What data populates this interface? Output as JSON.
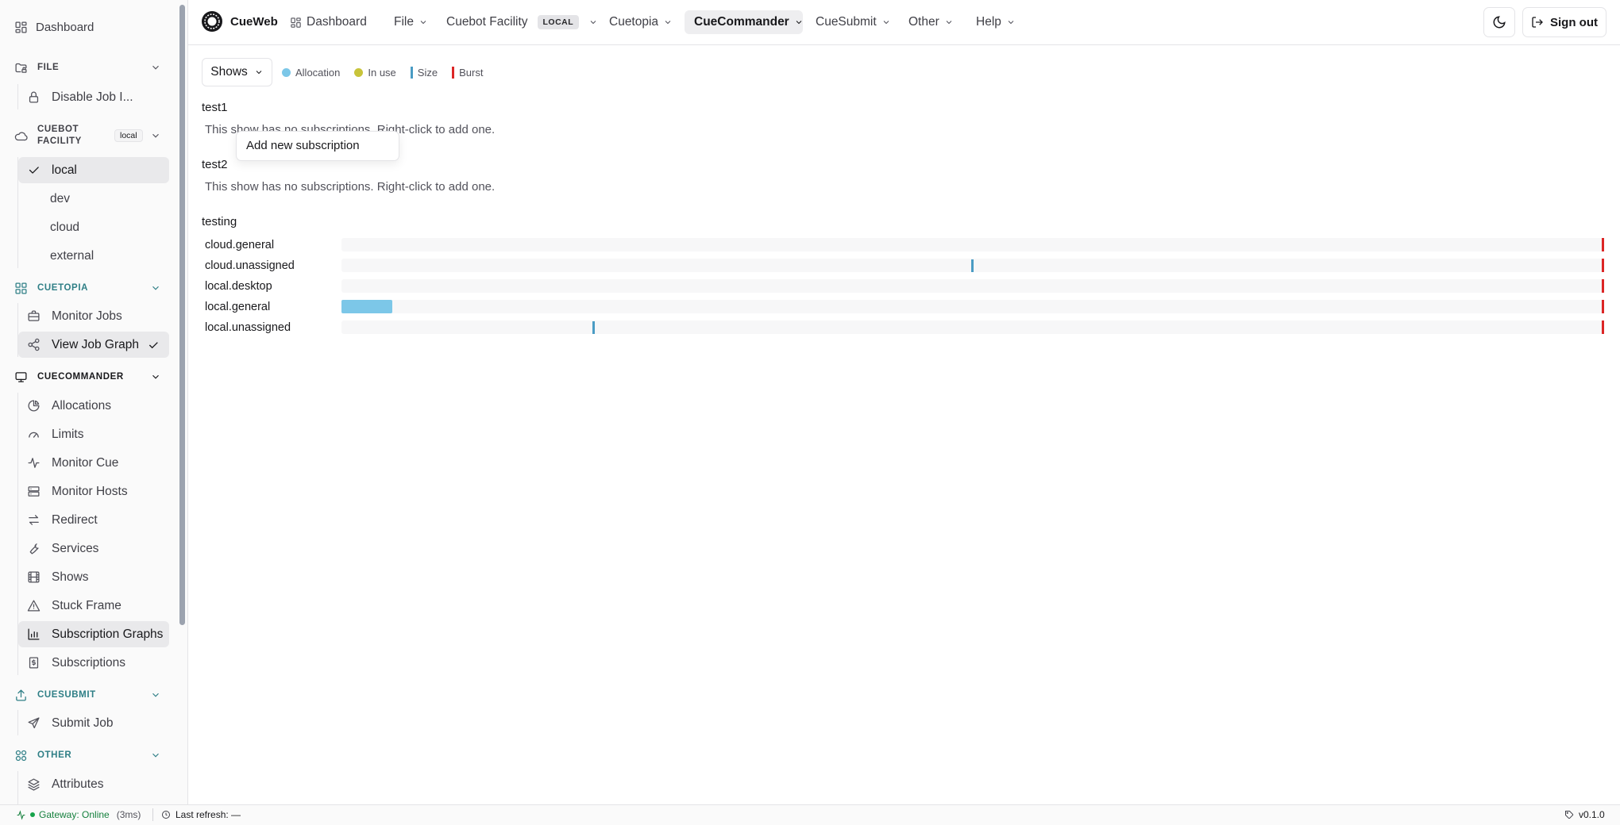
{
  "sidebar": {
    "dashboard_label": "Dashboard",
    "sections": {
      "file": "FILE",
      "cuebot": "CUEBOT FACILITY",
      "cuebot_badge": "local",
      "cuetopia": "CUETOPIA",
      "cuecommander": "CUECOMMANDER",
      "cuesubmit": "CUESUBMIT",
      "other": "OTHER"
    },
    "file_items": [
      "Disable Job I..."
    ],
    "facility_items": [
      "local",
      "dev",
      "cloud",
      "external"
    ],
    "cuetopia_items": [
      "Monitor Jobs",
      "View Job Graph"
    ],
    "cuecommander_items": [
      "Allocations",
      "Limits",
      "Monitor Cue",
      "Monitor Hosts",
      "Redirect",
      "Services",
      "Shows",
      "Stuck Frame",
      "Subscription Graphs",
      "Subscriptions"
    ],
    "cuesubmit_items": [
      "Submit Job"
    ],
    "other_items": [
      "Attributes"
    ]
  },
  "header": {
    "brand": "CueWeb",
    "nav": {
      "dashboard": "Dashboard",
      "file": "File",
      "cuebot": "Cuebot Facility",
      "cuebot_badge": "LOCAL",
      "cuetopia": "Cuetopia",
      "cuecommander": "CueCommander",
      "cuesubmit": "CueSubmit",
      "other": "Other",
      "help": "Help"
    },
    "sign_out": "Sign out"
  },
  "toolbar": {
    "shows_label": "Shows",
    "legend": {
      "allocation": "Allocation",
      "in_use": "In use",
      "size": "Size",
      "burst": "Burst"
    }
  },
  "colors": {
    "allocation": "#7cc7e8",
    "in_use": "#c8c43a",
    "size": "#4a9cc4",
    "burst": "#dc2626"
  },
  "shows": [
    {
      "name": "test1",
      "empty_message": "This show has no subscriptions. Right-click to add one."
    },
    {
      "name": "test2",
      "empty_message": "This show has no subscriptions. Right-click to add one."
    },
    {
      "name": "testing"
    }
  ],
  "subscriptions": [
    {
      "label": "cloud.general",
      "allocation_fraction": 0.0,
      "size_fraction": null,
      "burst_fraction": 1.0
    },
    {
      "label": "cloud.unassigned",
      "allocation_fraction": 0.0,
      "size_fraction": 0.5,
      "burst_fraction": 1.0
    },
    {
      "label": "local.desktop",
      "allocation_fraction": 0.0,
      "size_fraction": null,
      "burst_fraction": 1.0
    },
    {
      "label": "local.general",
      "allocation_fraction": 0.04,
      "size_fraction": null,
      "burst_fraction": 1.0
    },
    {
      "label": "local.unassigned",
      "allocation_fraction": 0.0,
      "size_fraction": 0.2,
      "burst_fraction": 1.0
    }
  ],
  "context_menu": {
    "item": "Add new subscription"
  },
  "footer": {
    "gateway": "Gateway: Online",
    "latency": "(3ms)",
    "last_refresh": "Last refresh: —",
    "version": "v0.1.0"
  }
}
